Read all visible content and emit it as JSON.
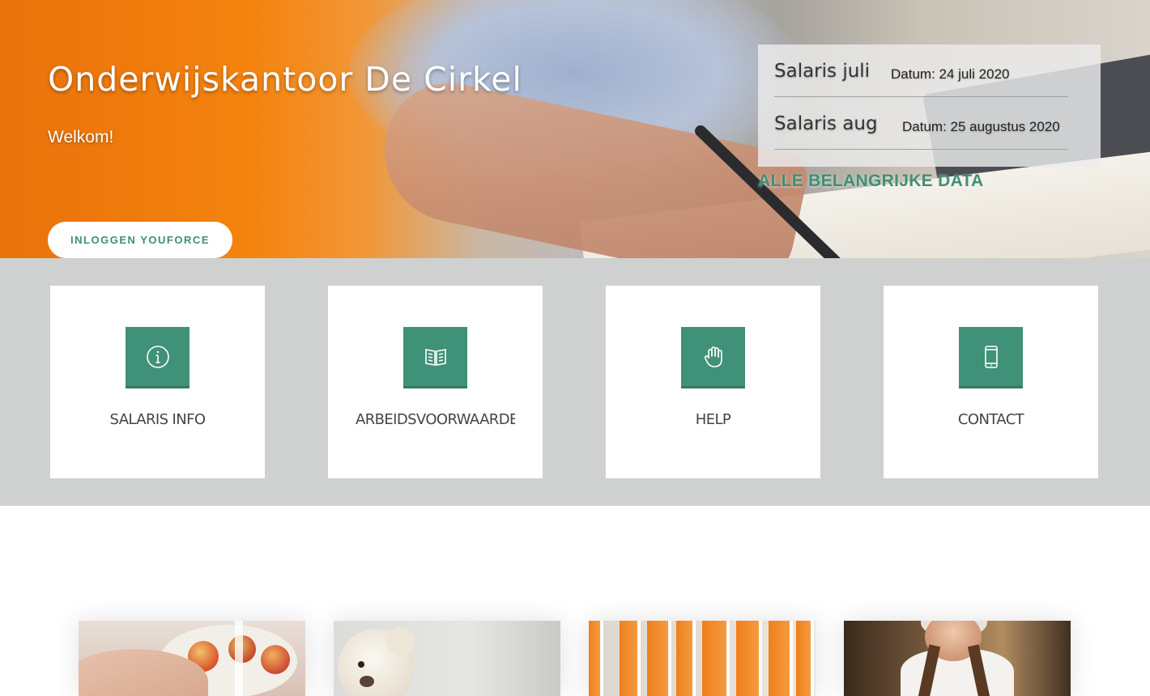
{
  "hero": {
    "title": "Onderwijskantoor De Cirkel",
    "subtitle": "Welkom!",
    "login_button": "INLOGGEN YOUFORCE"
  },
  "dates": {
    "items": [
      {
        "name": "Salaris juli",
        "date": "Datum: 24 juli 2020"
      },
      {
        "name": "Salaris aug",
        "date": "Datum: 25 augustus 2020"
      }
    ],
    "all_link": "ALLE BELANGRIJKE DATA"
  },
  "services": [
    {
      "label": "SALARIS INFO",
      "icon": "info-icon"
    },
    {
      "label": "ARBEIDSVOORWAARDEN",
      "icon": "book-icon"
    },
    {
      "label": "HELP",
      "icon": "hand-icon"
    },
    {
      "label": "CONTACT",
      "icon": "phone-icon"
    }
  ],
  "colors": {
    "accent": "#3f9177",
    "hero_orange": "#f5860f",
    "services_bg": "#cfd1d0"
  }
}
